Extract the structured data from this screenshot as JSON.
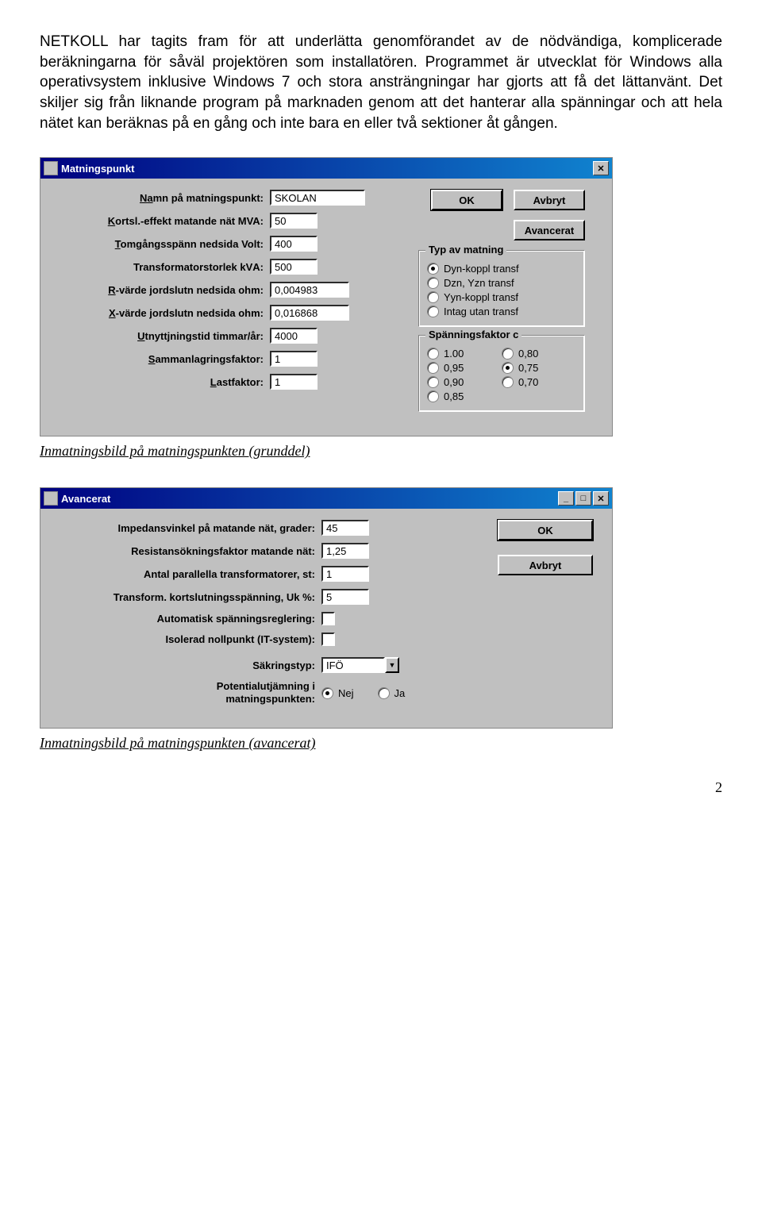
{
  "intro": "NETKOLL har tagits fram för att underlätta genomförandet av de nödvändiga, komplicerade beräkningarna för såväl projektören som installatören. Programmet är utvecklat för Windows alla operativsystem inklusive Windows 7 och stora ansträngningar har gjorts att få det lättanvänt. Det skiljer sig från liknande program på marknaden genom att det hanterar alla spänningar och att hela nätet kan beräknas på en gång och inte bara en eller två sektioner åt gången.",
  "window1": {
    "title": "Matningspunkt",
    "buttons": {
      "ok": "OK",
      "cancel": "Avbryt",
      "advanced": "Avancerat"
    },
    "fields": {
      "namn": {
        "label_pre": "N",
        "label_u": "a",
        "label_post": "mn på matningspunkt:",
        "value": "SKOLAN"
      },
      "kortsl": {
        "label_u": "K",
        "label_post": "ortsl.-effekt matande nät MVA:",
        "value": "50"
      },
      "tomg": {
        "label_u": "T",
        "label_post": "omgångsspänn nedsida Volt:",
        "value": "400"
      },
      "trafo": {
        "label": "Transformatorstorlek kVА:",
        "value": "500"
      },
      "rvarde": {
        "label_u": "R",
        "label_post": "-värde jordslutn nedsida ohm:",
        "value": "0,004983"
      },
      "xvarde": {
        "label_u": "X",
        "label_post": "-värde jordslutn nedsida ohm:",
        "value": "0,016868"
      },
      "utnyttj": {
        "label_u": "U",
        "label_post": "tnyttjningstid timmar/år:",
        "value": "4000"
      },
      "samman": {
        "label_u": "S",
        "label_post": "ammanlagringsfaktor:",
        "value": "1"
      },
      "last": {
        "label_u": "L",
        "label_post": "astfaktor:",
        "value": "1"
      }
    },
    "typ_group": {
      "legend": "Typ av matning",
      "options": [
        "Dyn-koppl transf",
        "Dzn, Yzn   transf",
        "Yyn-koppl transf",
        "Intag utan transf"
      ],
      "selected": 0
    },
    "sf_group": {
      "legend": "Spänningsfaktor c",
      "options_left": [
        "1.00",
        "0,95",
        "0,90",
        "0,85"
      ],
      "options_right": [
        "0,80",
        "0,75",
        "0,70"
      ],
      "selected": "0,75"
    }
  },
  "caption1": "Inmatningsbild på matningspunkten (grunddel)",
  "window2": {
    "title": "Avancerat",
    "buttons": {
      "ok": "OK",
      "cancel": "Avbryt"
    },
    "fields": {
      "imp": {
        "label": "Impedansvinkel på matande nät, grader:",
        "value": "45"
      },
      "res": {
        "label": "Resistansökningsfaktor matande nät:",
        "value": "1,25"
      },
      "antal": {
        "label": "Antal parallella transformatorer, st:",
        "value": "1"
      },
      "uk": {
        "label": "Transform. kortslutningsspänning, Uk %:",
        "value": "5"
      },
      "auto": {
        "label": "Automatisk spänningsreglering:"
      },
      "isol": {
        "label": "Isolerad nollpunkt (IT-system):"
      },
      "sakr": {
        "label": "Säkringstyp:",
        "value": "IFÖ"
      },
      "pot": {
        "label": "Potentialutjämning i\nmatningspunkten:",
        "opt_no": "Nej",
        "opt_yes": "Ja",
        "selected": "Nej"
      }
    }
  },
  "caption2": "Inmatningsbild på matningspunkten (avancerat)",
  "page_number": "2"
}
